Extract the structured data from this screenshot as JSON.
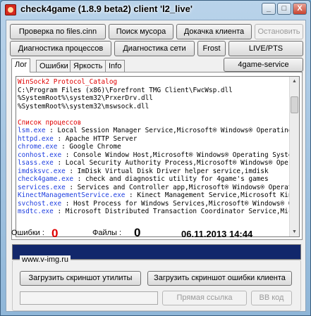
{
  "window": {
    "title": "check4game (1.8.9 beta2) client 'l2_live'",
    "controls": [
      "_",
      "□",
      "X"
    ]
  },
  "toolbar": {
    "row1": [
      "Проверка по files.cinn",
      "Поиск мусора",
      "Докачка клиента",
      "Остановить"
    ],
    "row2": [
      "Диагностика процессов",
      "Диагностика сети",
      "Frost",
      "LIVE/PTS"
    ]
  },
  "tabs": [
    "Лог",
    "Ошибки",
    "Яркость",
    "Info"
  ],
  "active_tab": "Лог",
  "service_button": "4game-service",
  "log": [
    {
      "text": "WinSock2 Protocol_Catalog",
      "color": "#e00000"
    },
    {
      "text": "C:\\Program Files (x86)\\Forefront TMG Client\\FwcWsp.dll",
      "color": "#000000"
    },
    {
      "text": "%SystemRoot%\\system32\\PrxerDrv.dll",
      "color": "#000000"
    },
    {
      "text": "%SystemRoot%\\system32\\mswsock.dll",
      "color": "#000000"
    },
    {
      "text": "",
      "color": "#000000"
    },
    {
      "text": "Список процессов",
      "color": "#e00000"
    },
    {
      "name": "lsm.exe",
      "desc": " : Local Session Manager Service,Microsoft® Windows® Operating Syst"
    },
    {
      "name": "httpd.exe",
      "desc": " : Apache HTTP Server"
    },
    {
      "name": "chrome.exe",
      "desc": " : Google Chrome"
    },
    {
      "name": "conhost.exe",
      "desc": " : Console Window Host,Microsoft® Windows® Operating System"
    },
    {
      "name": "lsass.exe",
      "desc": " : Local Security Authority Process,Microsoft® Windows® Operating"
    },
    {
      "name": "imdsksvc.exe",
      "desc": " : ImDisk Virtual Disk Driver helper service,imdisk"
    },
    {
      "name": "check4game.exe",
      "desc": " : check and diagnostic utility for 4game's games"
    },
    {
      "name": "services.exe",
      "desc": " : Services and Controller app,Microsoft® Windows® Operating Sy"
    },
    {
      "name": "KinectManagementService.exe",
      "desc": " : Kinect Management Service,Microsoft Kinect f"
    },
    {
      "name": "svchost.exe",
      "desc": " : Host Process for Windows Services,Microsoft® Windows® Operati"
    },
    {
      "name": "msdtc.exe",
      "desc": " : Microsoft Distributed Transaction Coordinator Service,Microso"
    }
  ],
  "stats": {
    "errors_label": "Ошибки :",
    "errors_value": "0",
    "errors_color": "#e00000",
    "files_label": "Файлы :",
    "files_value": "0",
    "datetime": "06.11.2013 14:44"
  },
  "progress": {
    "fraction": 1.0,
    "color": "#12276b"
  },
  "upload": {
    "group_title": "www.v-img.ru",
    "screenshot_utility": "Загрузить скриншот утилиты",
    "screenshot_error": "Загрузить скриншот ошибки клиента",
    "direct_link": "Прямая ссылка",
    "bb_code": "BB код"
  }
}
